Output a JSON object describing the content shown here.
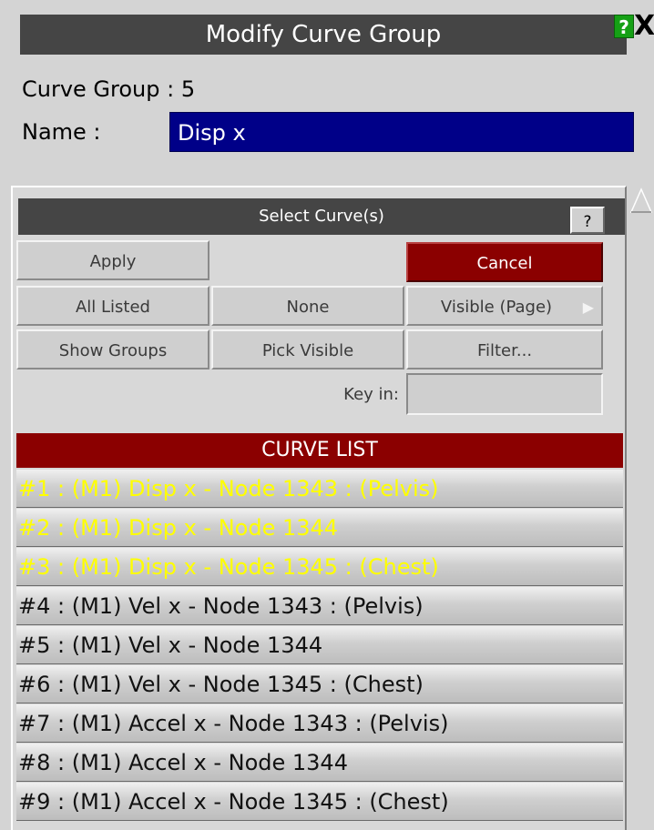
{
  "window": {
    "title": "Modify Curve Group",
    "help_label": "?",
    "close_label": "X"
  },
  "group": {
    "label": "Curve Group : 5",
    "name_label": "Name :",
    "name_value": "Disp x"
  },
  "select": {
    "title": "Select Curve(s)",
    "help_label": "?",
    "apply_label": "Apply",
    "cancel_label": "Cancel",
    "all_listed_label": "All Listed",
    "none_label": "None",
    "visible_page_label": "Visible (Page)",
    "show_groups_label": "Show Groups",
    "pick_visible_label": "Pick Visible",
    "filter_label": "Filter...",
    "key_in_label": "Key in:",
    "key_in_value": ""
  },
  "curve_list": {
    "header": "CURVE LIST",
    "items": [
      {
        "label": "#1 : (M1) Disp x - Node 1343 : (Pelvis)",
        "selected": true
      },
      {
        "label": "#2 : (M1) Disp x - Node 1344",
        "selected": true
      },
      {
        "label": "#3 : (M1) Disp x - Node 1345 : (Chest)",
        "selected": true
      },
      {
        "label": "#4 : (M1) Vel x - Node 1343 : (Pelvis)",
        "selected": false
      },
      {
        "label": "#5 : (M1) Vel x - Node 1344",
        "selected": false
      },
      {
        "label": "#6 : (M1) Vel x - Node 1345 : (Chest)",
        "selected": false
      },
      {
        "label": "#7 : (M1) Accel x - Node 1343 : (Pelvis)",
        "selected": false
      },
      {
        "label": "#8 : (M1) Accel x - Node 1344",
        "selected": false
      },
      {
        "label": "#9 : (M1) Accel x - Node 1345 : (Chest)",
        "selected": false
      }
    ]
  }
}
